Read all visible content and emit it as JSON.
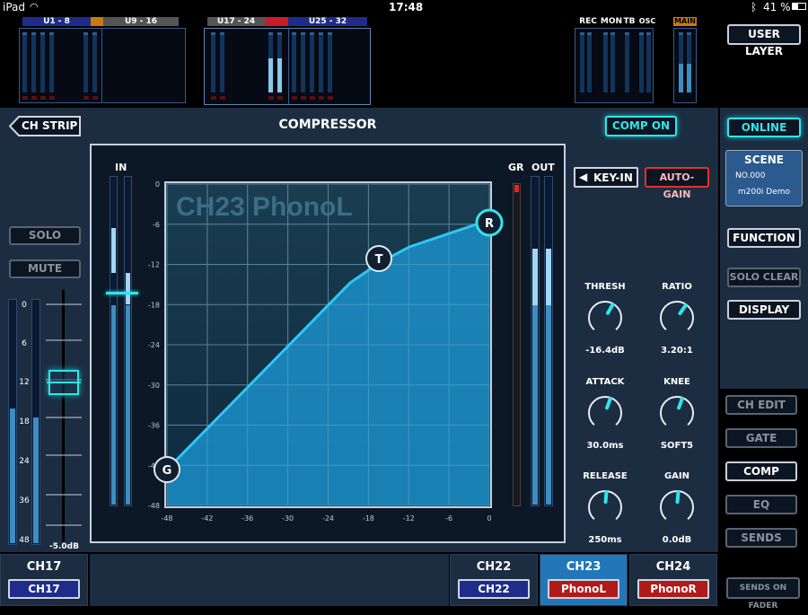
{
  "status": {
    "device": "iPad",
    "time": "17:48",
    "battery": "41 %"
  },
  "meter_groups": [
    {
      "label": "U1 - 8",
      "color": "#1e2d8c"
    },
    {
      "label": "U9 - 16",
      "color": "#555555"
    },
    {
      "label": "U17 - 24",
      "color": "#555555"
    },
    {
      "label": "U25 - 32",
      "color": "#1e2d8c"
    }
  ],
  "master_meters": {
    "rec": "REC",
    "mon": "MON",
    "tb": "TB",
    "osc": "OSC",
    "main": "MAIN"
  },
  "user_layer_label": "USER LAYER",
  "panel": {
    "back_label": "CH STRIP",
    "title": "COMPRESSOR",
    "comp_on_label": "COMP ON",
    "key_in_label": "KEY-IN",
    "auto_gain_label": "AUTO-GAIN",
    "solo_label": "SOLO",
    "mute_label": "MUTE",
    "fader_value": "-5.0dB",
    "fader_scale": [
      "0",
      "6",
      "12",
      "18",
      "24",
      "36",
      "48"
    ],
    "in_label": "IN",
    "gr_label": "GR",
    "out_label": "OUT",
    "graph_watermark": "CH23  PhonoL",
    "y_ticks": [
      "0",
      "-6",
      "-12",
      "-18",
      "-24",
      "-30",
      "-36",
      "-42",
      "-48"
    ],
    "x_ticks": [
      "-48",
      "-42",
      "-36",
      "-30",
      "-24",
      "-18",
      "-12",
      "-6",
      "0"
    ],
    "handles": {
      "g": "G",
      "t": "T",
      "r": "R"
    }
  },
  "knobs": [
    {
      "label": "THRESH",
      "value": "-16.4dB",
      "angle": 30
    },
    {
      "label": "RATIO",
      "value": "3.20:1",
      "angle": 35
    },
    {
      "label": "ATTACK",
      "value": "30.0ms",
      "angle": 20
    },
    {
      "label": "KNEE",
      "value": "SOFT5",
      "angle": 20
    },
    {
      "label": "RELEASE",
      "value": "250ms",
      "angle": 5
    },
    {
      "label": "GAIN",
      "value": "0.0dB",
      "angle": 5
    }
  ],
  "right": {
    "online_label": "ONLINE",
    "scene_title": "SCENE",
    "scene_no": "NO.000",
    "scene_name": "m200i Demo",
    "function_label": "FUNCTION",
    "solo_clear_label": "SOLO CLEAR",
    "display_label": "DISPLAY",
    "ch_edit_label": "CH EDIT",
    "gate_label": "GATE",
    "comp_label": "COMP",
    "eq_label": "EQ",
    "sends_label": "SENDS",
    "sends_on_fader_label": "SENDS ON FADER"
  },
  "channels": [
    {
      "num": "CH17",
      "name": "CH17",
      "color": "#1e2d8c"
    },
    {
      "num": "CH22",
      "name": "CH22",
      "color": "#1e2d8c"
    },
    {
      "num": "CH23",
      "name": "PhonoL",
      "color": "#b01a1a"
    },
    {
      "num": "CH24",
      "name": "PhonoR",
      "color": "#b01a1a"
    }
  ]
}
